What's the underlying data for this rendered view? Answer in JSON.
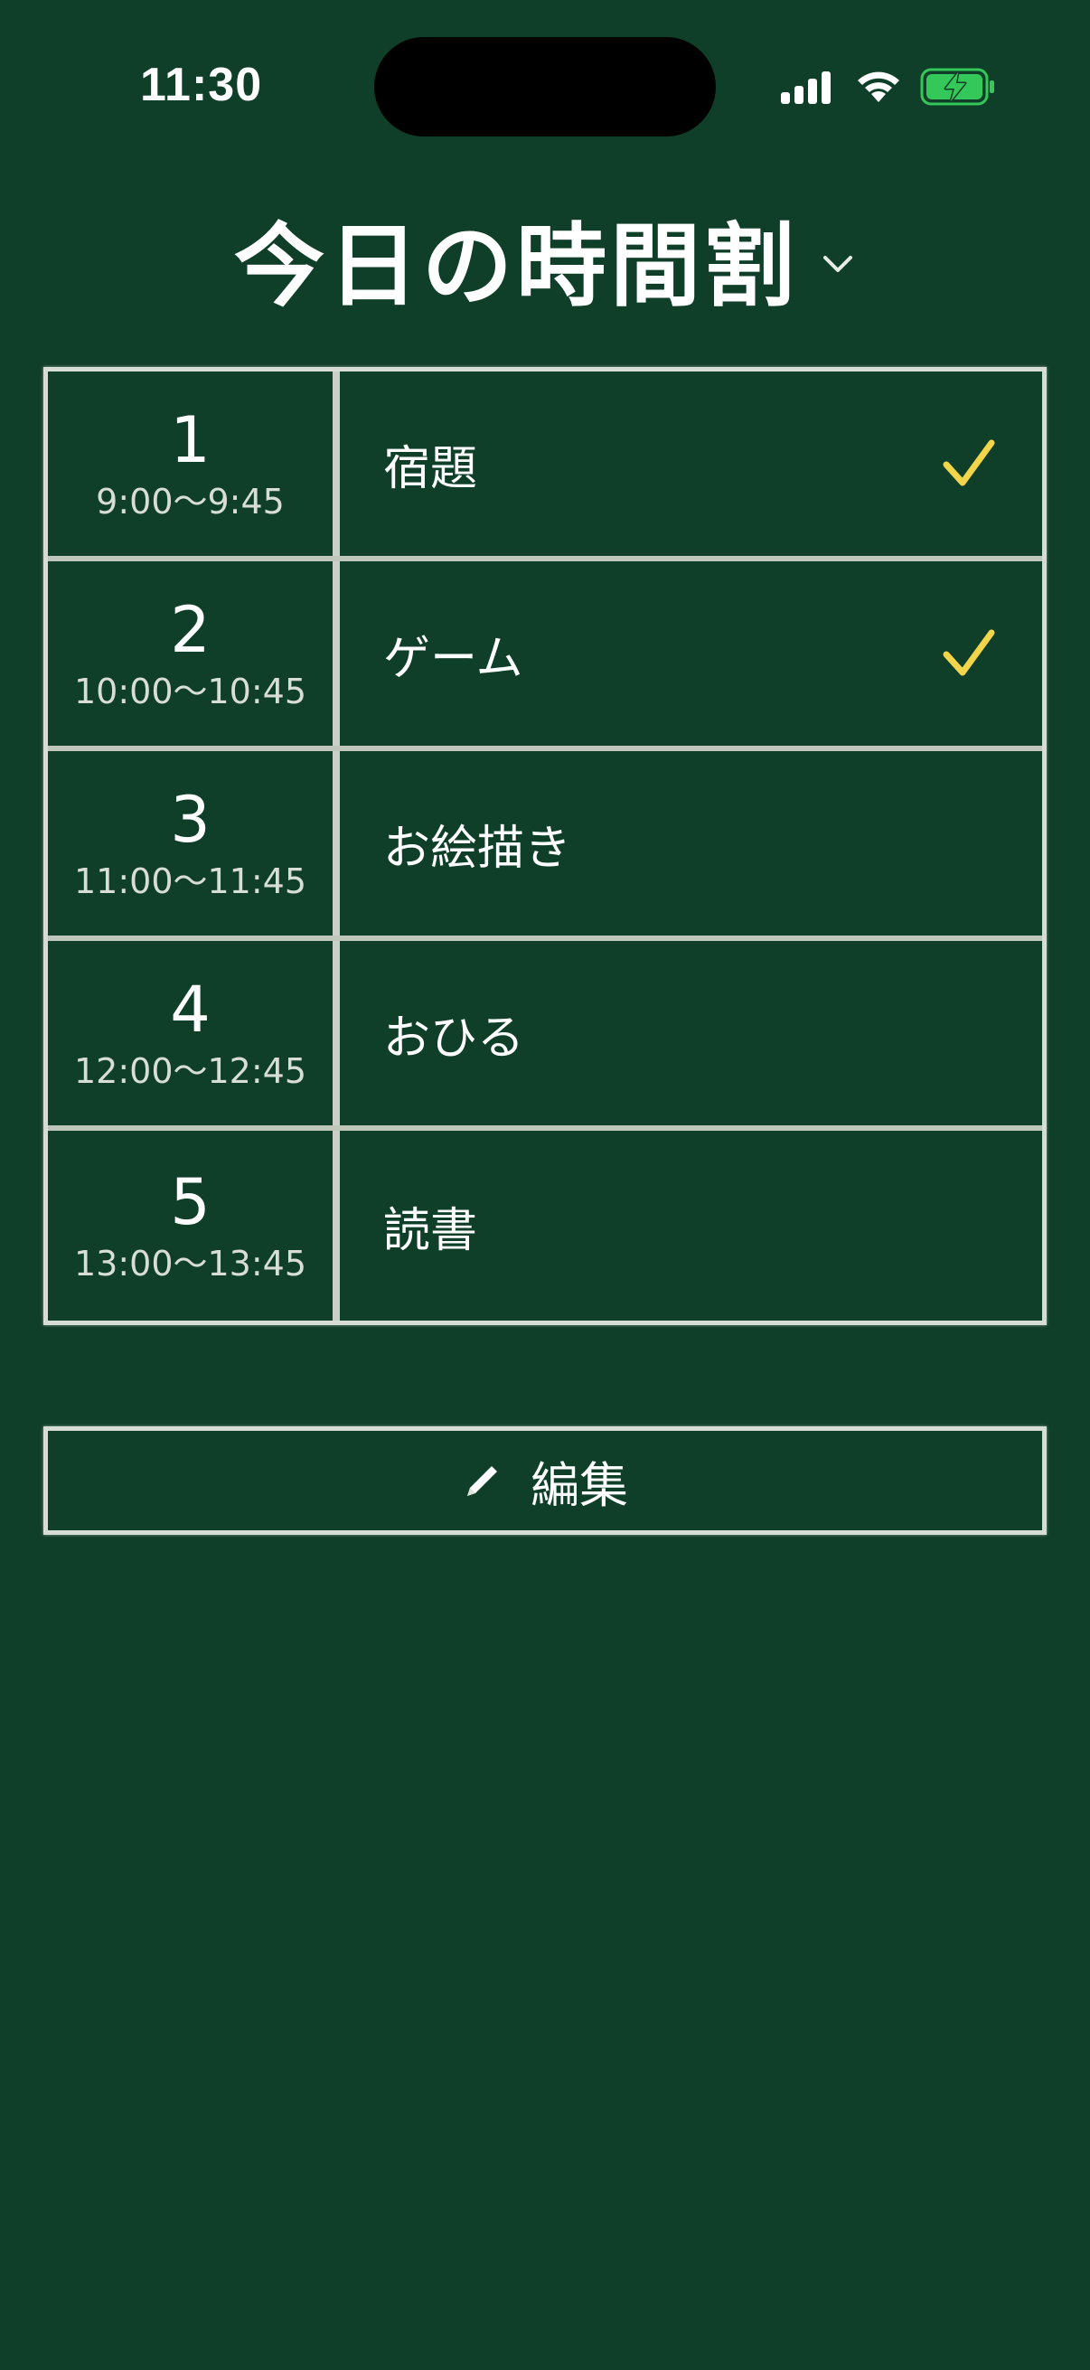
{
  "status_bar": {
    "time": "11:30"
  },
  "header": {
    "title": "今日の時間割",
    "dropdown_icon": "chevron-down-icon"
  },
  "timetable": {
    "rows": [
      {
        "period": "1",
        "time": "9:00〜9:45",
        "subject": "宿題",
        "done": true
      },
      {
        "period": "2",
        "time": "10:00〜10:45",
        "subject": "ゲーム",
        "done": true
      },
      {
        "period": "3",
        "time": "11:00〜11:45",
        "subject": "お絵描き",
        "done": false
      },
      {
        "period": "4",
        "time": "12:00〜12:45",
        "subject": "おひる",
        "done": false
      },
      {
        "period": "5",
        "time": "13:00〜13:45",
        "subject": "読書",
        "done": false
      }
    ]
  },
  "edit_button": {
    "label": "編集",
    "icon": "pencil-icon"
  },
  "colors": {
    "background": "#0f3f29",
    "chalk_line": "#d7dcd5",
    "check": "#f2d54a",
    "battery": "#34c759"
  }
}
